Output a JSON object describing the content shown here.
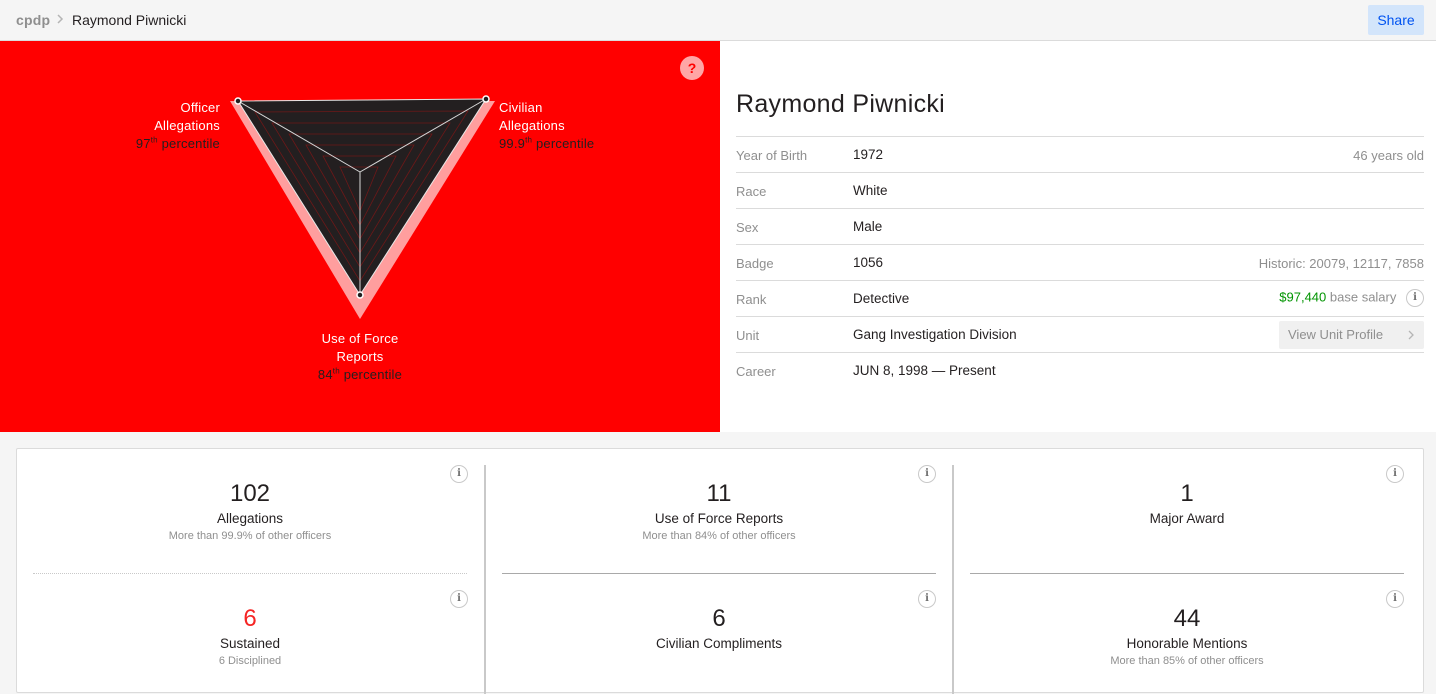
{
  "header": {
    "brand": "cpdp",
    "breadcrumb_name": "Raymond Piwnicki",
    "share_label": "Share"
  },
  "radar": {
    "help_label": "?",
    "background_color": "#ff0000",
    "axes": [
      {
        "name_line1": "Officer",
        "name_line2": "Allegations",
        "percentile_value": "97",
        "percentile_sup": "th",
        "percentile_word": "percentile",
        "percentile": 97
      },
      {
        "name_line1": "Civilian",
        "name_line2": "Allegations",
        "percentile_value": "99.9",
        "percentile_sup": "th",
        "percentile_word": "percentile",
        "percentile": 99.9
      },
      {
        "name_line1": "Use of Force",
        "name_line2": "Reports",
        "percentile_value": "84",
        "percentile_sup": "th",
        "percentile_word": "percentile",
        "percentile": 84
      }
    ]
  },
  "officer": {
    "name": "Raymond Piwnicki",
    "rows": [
      {
        "key": "Year of Birth",
        "value": "1972",
        "extra": "46 years old"
      },
      {
        "key": "Race",
        "value": "White",
        "extra": ""
      },
      {
        "key": "Sex",
        "value": "Male",
        "extra": ""
      },
      {
        "key": "Badge",
        "value": "1056",
        "extra": "Historic: 20079, 12117, 7858"
      },
      {
        "key": "Rank",
        "value": "Detective",
        "salary_amount": "$97,440",
        "salary_label": "base salary",
        "info": "i"
      },
      {
        "key": "Unit",
        "value": "Gang Investigation Division",
        "button_label": "View Unit Profile"
      },
      {
        "key": "Career",
        "value": "JUN 8, 1998 — Present"
      }
    ],
    "colors": {
      "salary": "#009400"
    }
  },
  "metrics": {
    "info_label": "i",
    "items": [
      {
        "number": "102",
        "name": "Allegations",
        "desc": "More than 99.9% of other officers"
      },
      {
        "number": "11",
        "name": "Use of Force Reports",
        "desc": "More than 84% of other officers"
      },
      {
        "number": "1",
        "name": "Major Award",
        "desc": ""
      },
      {
        "number": "6",
        "name": "Sustained",
        "desc": "6 Disciplined"
      },
      {
        "number": "6",
        "name": "Civilian Compliments",
        "desc": ""
      },
      {
        "number": "44",
        "name": "Honorable Mentions",
        "desc": "More than 85% of other officers"
      }
    ],
    "colors": {
      "sustained_number": "#f52524"
    }
  }
}
